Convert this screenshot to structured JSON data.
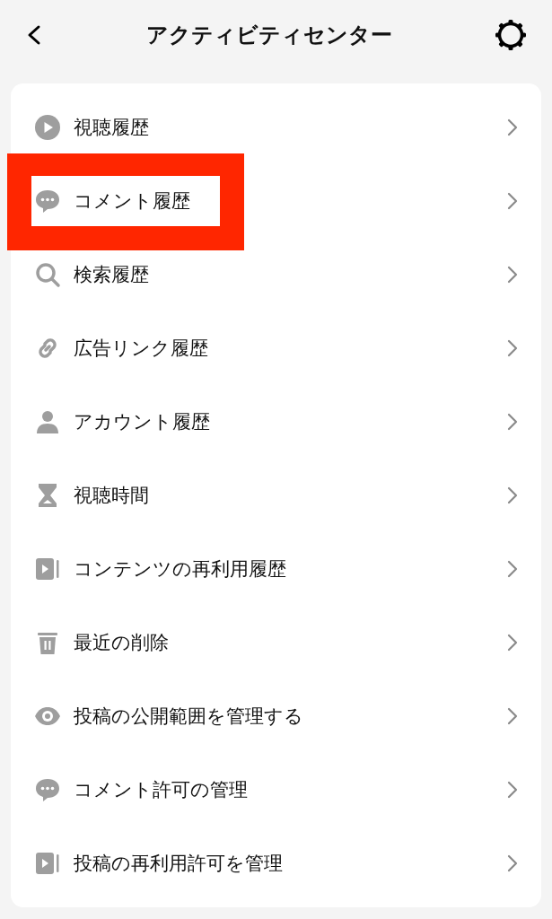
{
  "header": {
    "title": "アクティビティセンター"
  },
  "items": [
    {
      "kind": "play",
      "label": "視聴履歴",
      "highlighted": false
    },
    {
      "kind": "comment",
      "label": "コメント履歴",
      "highlighted": true
    },
    {
      "kind": "search",
      "label": "検索履歴",
      "highlighted": false
    },
    {
      "kind": "link",
      "label": "広告リンク履歴",
      "highlighted": false
    },
    {
      "kind": "person",
      "label": "アカウント履歴",
      "highlighted": false
    },
    {
      "kind": "hourglass",
      "label": "視聴時間",
      "highlighted": false
    },
    {
      "kind": "video",
      "label": "コンテンツの再利用履歴",
      "highlighted": false
    },
    {
      "kind": "trash",
      "label": "最近の削除",
      "highlighted": false
    },
    {
      "kind": "eye",
      "label": "投稿の公開範囲を管理する",
      "highlighted": false
    },
    {
      "kind": "comment",
      "label": "コメント許可の管理",
      "highlighted": false
    },
    {
      "kind": "video",
      "label": "投稿の再利用許可を管理",
      "highlighted": false
    }
  ]
}
